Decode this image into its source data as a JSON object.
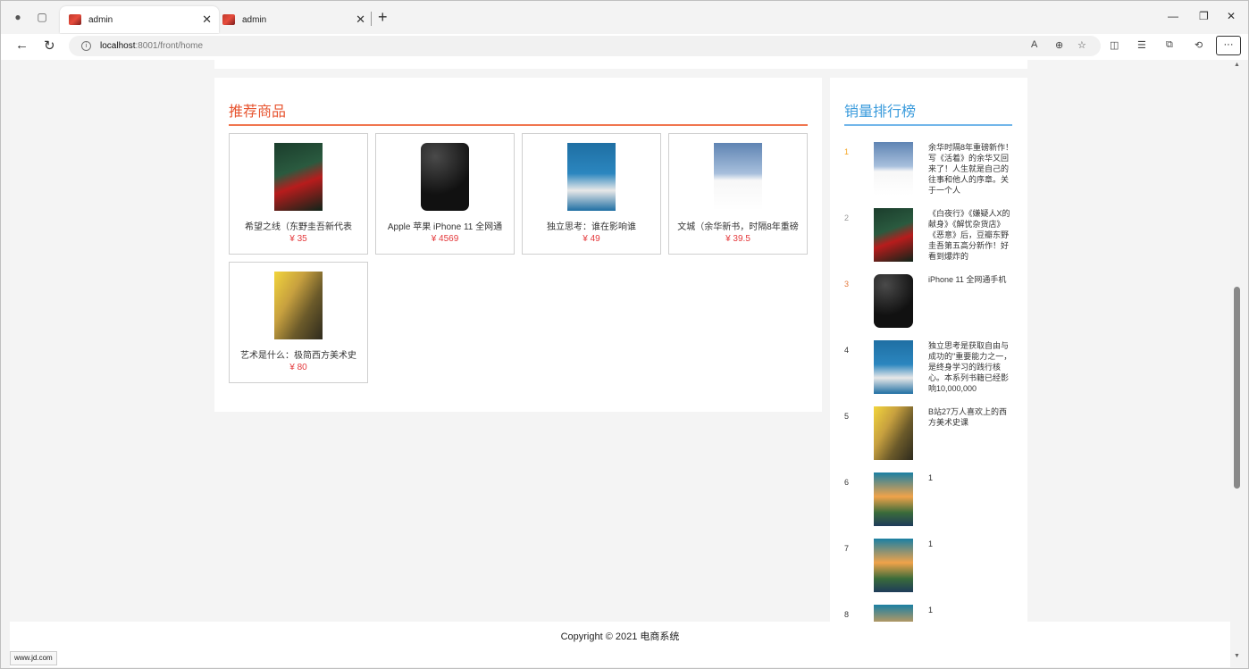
{
  "browser": {
    "tabs": [
      {
        "title": "admin",
        "active": true
      },
      {
        "title": "admin",
        "active": false
      }
    ],
    "url_host": "localhost",
    "url_path": ":8001/front/home",
    "status_url": "www.jd.com"
  },
  "recommend": {
    "title": "推荐商品",
    "products": [
      {
        "name": "希望之线（东野圭吾新代表",
        "price": "¥ 35",
        "cover": "b-hope"
      },
      {
        "name": "Apple 苹果 iPhone 11 全网通",
        "price": "¥ 4569",
        "cover": "b-phone"
      },
      {
        "name": "独立思考：谁在影响谁",
        "price": "¥ 49",
        "cover": "b-think"
      },
      {
        "name": "文城（余华新书，时隔8年重磅",
        "price": "¥ 39.5",
        "cover": "b-wall"
      },
      {
        "name": "艺术是什么：极简西方美术史",
        "price": "¥ 80",
        "cover": "b-art"
      }
    ]
  },
  "ranking": {
    "title": "销量排行榜",
    "items": [
      {
        "no": "1",
        "text": "余华时隔8年重磅新作！写《活着》的余华又回来了！人生就是自己的往事和他人的序章。关于一个人",
        "cover": "b-wall",
        "color": "#f5a623"
      },
      {
        "no": "2",
        "text": "《白夜行》《嫌疑人X的献身》《解忧杂货店》《恶意》后，豆瓣东野圭吾第五高分新作！好看到爆炸的",
        "cover": "b-hope",
        "color": "#999999"
      },
      {
        "no": "3",
        "text": "iPhone 11 全网通手机",
        "cover": "b-phone",
        "color": "#e4793c"
      },
      {
        "no": "4",
        "text": "独立思考是获取自由与成功的\"重要能力之一，是终身学习的践行核心。本系列书籍已经影响10,000,000",
        "cover": "b-think",
        "color": "#333333"
      },
      {
        "no": "5",
        "text": "B站27万人喜欢上的西方美术史课",
        "cover": "b-art",
        "color": "#333333"
      },
      {
        "no": "6",
        "text": "1",
        "cover": "b-movie",
        "color": "#333333"
      },
      {
        "no": "7",
        "text": "1",
        "cover": "b-movie",
        "color": "#333333"
      },
      {
        "no": "8",
        "text": "1",
        "cover": "b-movie",
        "color": "#333333"
      }
    ]
  },
  "footer": {
    "copyright": "Copyright © 2021 电商系统"
  }
}
